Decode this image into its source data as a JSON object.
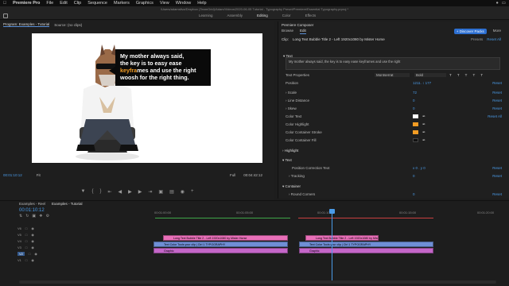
{
  "menubar": {
    "app": "Premiere Pro",
    "items": [
      "File",
      "Edit",
      "Clip",
      "Sequence",
      "Markers",
      "Graphics",
      "View",
      "Window",
      "Help"
    ]
  },
  "title": "/Users/adamsilva/Dropbox (TeamGrid)/Adam/Videos/2020-06-05 Tutorial - Typography Preset/Premiere/Essential Typography.prproj *",
  "workspaces": [
    "Learning",
    "Assembly",
    "Editing",
    "Color",
    "Effects"
  ],
  "workspace_active": "Editing",
  "program": {
    "tabs": [
      "Program: Examples - Tutorial",
      "Source: (no clips)"
    ],
    "bubble": {
      "line1": "My mother always said,",
      "line2": "the key is to easy ease",
      "hl": "keyfra",
      "line3_rest": "mes and use the right",
      "line4": "woosh for the right thing."
    },
    "timecode": "00:01:10:12",
    "fit": "Fit",
    "quality": "Full",
    "duration": "00:04:42:12"
  },
  "eg": {
    "title": "Premiere Composer",
    "tabs": [
      "Browse",
      "Edit"
    ],
    "discover": "+ Discover Packs",
    "more": "More",
    "clip_label": "Clip:",
    "clip_name": "Long Text Bubble Title 2 - Left 1920x1080 by Mister Horse",
    "presets": "Presets",
    "text_header": "Text",
    "text_value": "My mother always said, the key is to easy ease keyframes and use the right",
    "text_props": "Text Properties",
    "font": "Montserrat",
    "weight": "Bold",
    "rows": [
      {
        "label": "Position",
        "value": "1211.  ↕  177",
        "reset": "Reset"
      },
      {
        "label": "Scale",
        "value": "72",
        "reset": "Reset"
      },
      {
        "label": "Line Distance",
        "value": "0",
        "reset": "Reset"
      },
      {
        "label": "Skew",
        "value": "0",
        "reset": "Reset"
      }
    ],
    "colors": [
      {
        "label": "Color Text",
        "hex": "#ffffff"
      },
      {
        "label": "Color Highlight",
        "hex": "#f29c24"
      },
      {
        "label": "Color Container Stroke",
        "hex": "#f29c24"
      },
      {
        "label": "Color Container Fill",
        "hex": "#111111"
      }
    ],
    "reset_all": "Reset All",
    "highlight": "Highlight",
    "text2": "Text",
    "pos_corr": "Position Correction Text",
    "pos_corr_val": "x 0 . y 0",
    "tracking": "Tracking",
    "tracking_val": "0",
    "container": "Container",
    "round_corners": "Round Corners"
  },
  "timeline": {
    "tabs": [
      "Examples - Reel",
      "Examples - Tutorial"
    ],
    "timecode": "00:01:10:12",
    "ruler": [
      "00:01:00:00",
      "00:01:05:00",
      "00:01:10:00",
      "00:01:15:00",
      "00:01:20:00"
    ],
    "tracks": [
      "V6",
      "V5",
      "V4",
      "V3",
      "V2",
      "V1"
    ],
    "clip_title": "Long Text Bubble Title 2 - Left 1920x1080 by Mister Horse",
    "clip_audio": "Text Color Tools your clip | Ctrl 1 TYPOGRAPHY",
    "clip_graphic": "Graphic"
  }
}
